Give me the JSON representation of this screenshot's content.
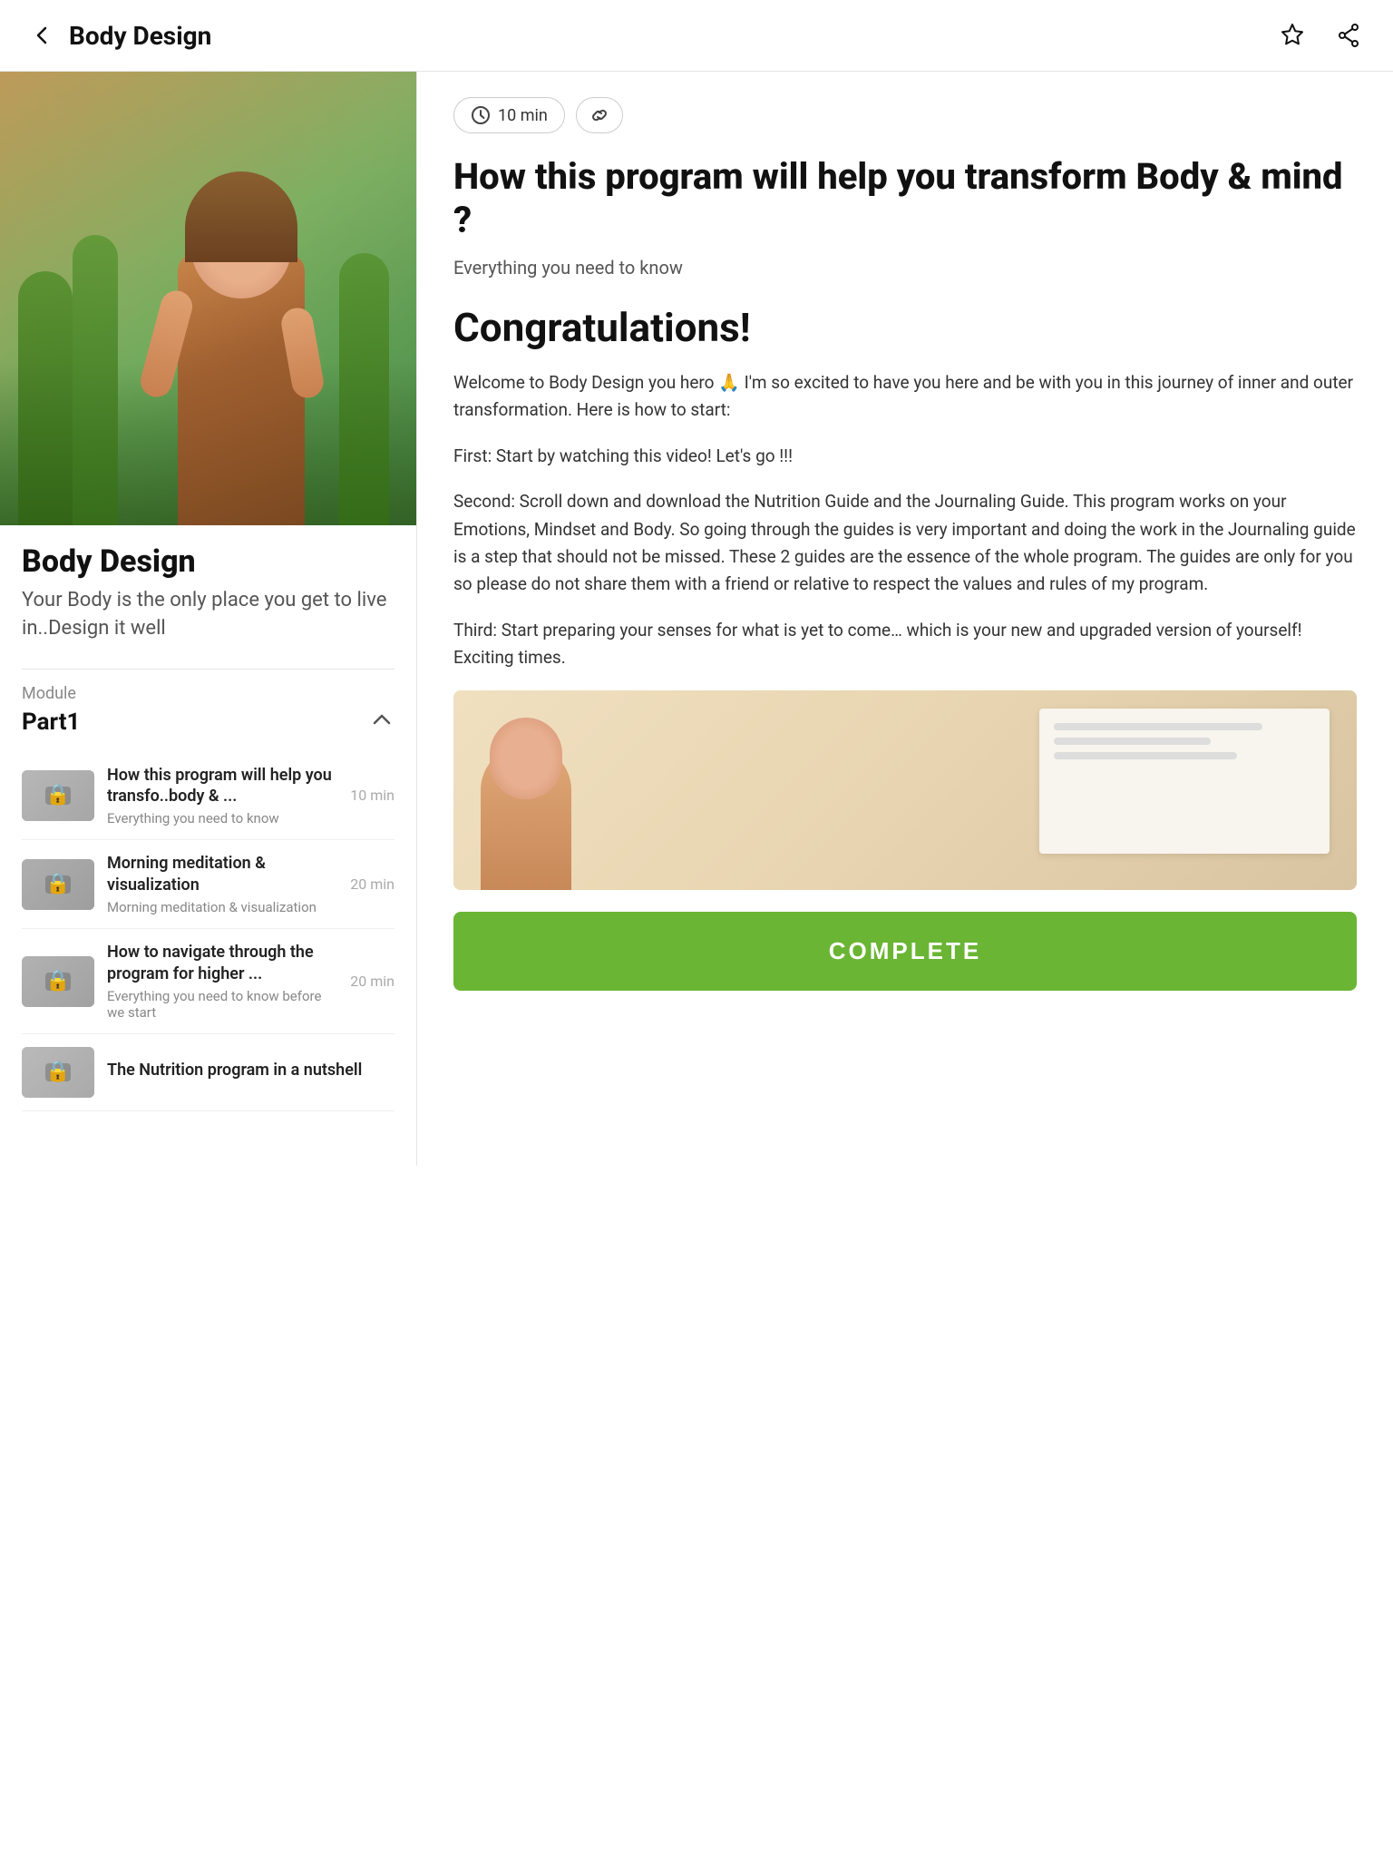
{
  "header": {
    "back_label": "Body Design",
    "bookmark_icon": "★",
    "share_icon": "⎘"
  },
  "left": {
    "program_title": "Body Design",
    "program_subtitle": "Your Body is the only place you get to live in..Design it well",
    "module_label": "Module",
    "module_name": "Part1",
    "lessons": [
      {
        "title": "How this program will help you transfo..body & ...",
        "desc": "Everything you need to know",
        "duration": "10 min",
        "locked": true
      },
      {
        "title": "Morning meditation & visualization",
        "desc": "Morning meditation & visualization",
        "duration": "20 min",
        "locked": true
      },
      {
        "title": "How to navigate through the program for higher ...",
        "desc": "Everything you need to know before we start",
        "duration": "20 min",
        "locked": true
      },
      {
        "title": "The Nutrition program in a nutshell",
        "desc": "",
        "duration": "",
        "locked": true
      }
    ]
  },
  "right": {
    "duration_label": "10 min",
    "content_title": "How this program will help you transform Body & mind ?",
    "content_intro": "Everything you need to know",
    "congrats_title": "Congratulations!",
    "body_paragraphs": [
      "Welcome to Body Design you hero 🙏 I'm so excited to have you here and be with you in this journey of inner and outer transformation. Here is how to start:",
      "First: Start by watching this video! Let's go !!!",
      "Second: Scroll down and download the Nutrition Guide and the Journaling Guide. This program works on your Emotions, Mindset and Body. So going through the guides is very important and doing the work in the Journaling guide is a step that should not be missed. These 2 guides are the essence of the whole program. The guides are only for you so please do not share them with a friend or relative to respect the values and rules of my program.",
      "Third: Start preparing your senses for what is yet to come… which is your new and upgraded version of yourself! Exciting times."
    ],
    "complete_label": "COMPLETE"
  }
}
